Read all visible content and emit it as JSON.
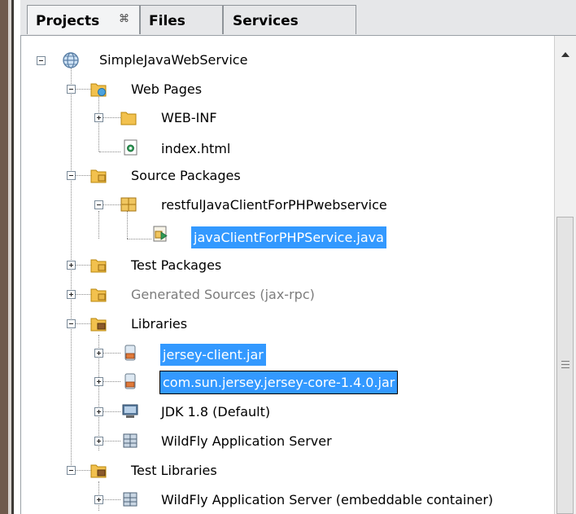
{
  "tabs": [
    {
      "label": "Projects",
      "close": "⌘",
      "active": true
    },
    {
      "label": "Files",
      "active": false
    },
    {
      "label": "Services",
      "active": false
    }
  ],
  "tree": {
    "root": "SimpleJavaWebService",
    "web_pages": "Web Pages",
    "web_inf": "WEB-INF",
    "index_html": "index.html",
    "source_packages": "Source Packages",
    "package": "restfulJavaClientForPHPwebservice",
    "java_file": "javaClientForPHPService.java",
    "test_packages": "Test Packages",
    "generated_sources": "Generated Sources (jax-rpc)",
    "libraries": "Libraries",
    "jersey_client": "jersey-client.jar",
    "jersey_core": "com.sun.jersey.jersey-core-1.4.0.jar",
    "jdk": "JDK 1.8 (Default)",
    "wildfly": "WildFly Application Server",
    "test_libraries": "Test Libraries",
    "wildfly_embedded": "WildFly Application Server (embeddable container)"
  },
  "colors": {
    "selection": "#3399ff",
    "folder": "#f2c14e",
    "package": "#e8b84a"
  }
}
